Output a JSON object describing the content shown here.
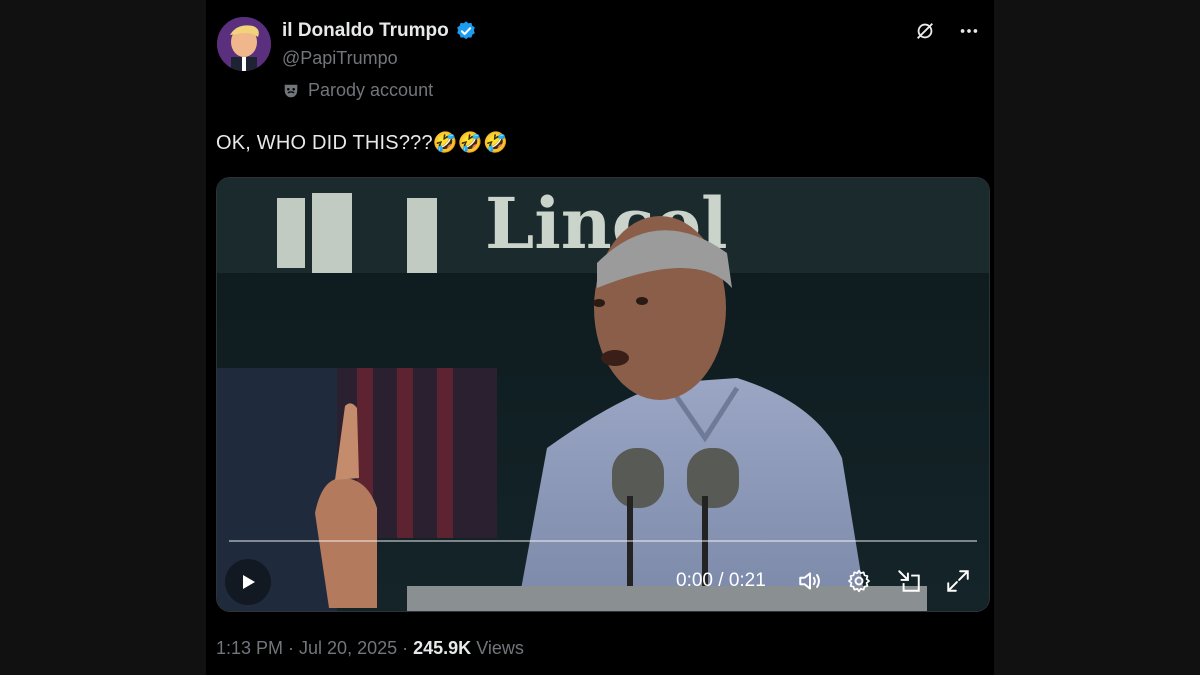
{
  "account": {
    "display_name": "il Donaldo Trumpo",
    "handle": "@PapiTrumpo",
    "label": "Parody account"
  },
  "tweet": {
    "text": "OK, WHO DID THIS???🤣🤣🤣"
  },
  "video": {
    "time": "0:00 / 0:21",
    "background_sign_text": "Lincol",
    "progress": 0
  },
  "meta": {
    "timestamp": "1:13 PM · Jul 20, 2025 ·",
    "views_count": "245.9K",
    "views_label": "Views"
  },
  "icons": {
    "verified": "verified-badge-icon",
    "grok": "grok-icon",
    "more": "more-icon",
    "parody": "theater-mask-icon",
    "play": "play-icon",
    "volume": "volume-icon",
    "settings": "gear-icon",
    "pip": "picture-in-picture-icon",
    "fullscreen": "fullscreen-icon"
  },
  "colors": {
    "background": "#000000",
    "text_primary": "#e7e9ea",
    "text_secondary": "#71767b",
    "verified_blue": "#1d9bf0"
  }
}
